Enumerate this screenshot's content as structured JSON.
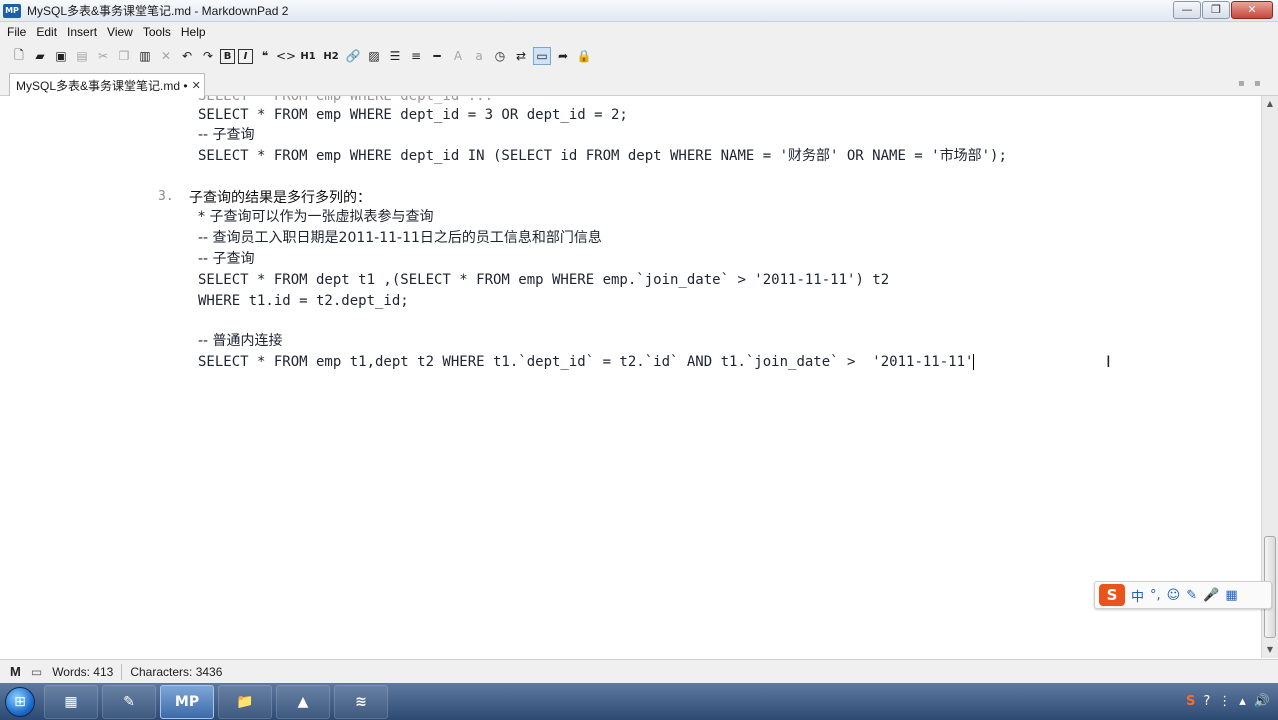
{
  "window": {
    "title": "MySQL多表&事务课堂笔记.md - MarkdownPad 2",
    "app_logo": "MP",
    "buttons": {
      "minimize": "—",
      "maximize": "❐",
      "close": "✕"
    }
  },
  "menu": [
    "File",
    "Edit",
    "Insert",
    "View",
    "Tools",
    "Help"
  ],
  "toolbar": {
    "icons": [
      "new-file-icon",
      "open-icon",
      "save-icon",
      "save-all-icon",
      "cut-icon",
      "copy-icon",
      "paste-icon",
      "delete-icon",
      "undo-icon",
      "redo-icon",
      "bold-icon",
      "italic-icon",
      "quote-icon",
      "code-icon",
      "h1-icon",
      "h2-icon",
      "link-icon",
      "image-icon",
      "bullet-list-icon",
      "numbered-list-icon",
      "hr-icon",
      "uppercase-icon",
      "lowercase-icon",
      "timestamp-icon",
      "preview-toggle-icon",
      "live-preview-icon",
      "export-icon",
      "lock-icon"
    ],
    "b_label": "B",
    "i_label": "I",
    "h1_label": "H1",
    "h2_label": "H2"
  },
  "tabs": [
    {
      "label": "MySQL多表&事务课堂笔记.md •",
      "close": "✕"
    }
  ],
  "editor": {
    "lines": {
      "l1": "SELECT * FROM emp WHERE dept_id = 3 OR dept_id = 2;",
      "l2": "-- 子查询",
      "l3": "SELECT * FROM emp WHERE dept_id IN (SELECT id FROM dept WHERE NAME = '财务部' OR NAME = '市场部');",
      "num3": "3.",
      "heading3": "子查询的结果是多行多列的：",
      "l4": "* 子查询可以作为一张虚拟表参与查询",
      "l5": "-- 查询员工入职日期是2011-11-11日之后的员工信息和部门信息",
      "l6": "-- 子查询",
      "l7": "SELECT * FROM dept t1 ,(SELECT * FROM emp WHERE emp.`join_date` > '2011-11-11') t2",
      "l8": "WHERE t1.id = t2.dept_id;",
      "l9": "-- 普通内连接",
      "l10": "SELECT * FROM emp t1,dept t2 WHERE t1.`dept_id` = t2.`id` AND t1.`join_date` >  '2011-11-11'"
    }
  },
  "ime": {
    "logo": "S",
    "items": [
      "中",
      "°,",
      "☺",
      "✎",
      "🎤",
      "▦"
    ]
  },
  "status": {
    "words": "Words: 413",
    "characters": "Characters: 3436"
  },
  "taskbar": {
    "apps": [
      "▦",
      "✎",
      "MP",
      "📁",
      "▲",
      "≋"
    ],
    "tray": [
      "S",
      "?",
      "⋮",
      "▴",
      "🔊"
    ]
  }
}
